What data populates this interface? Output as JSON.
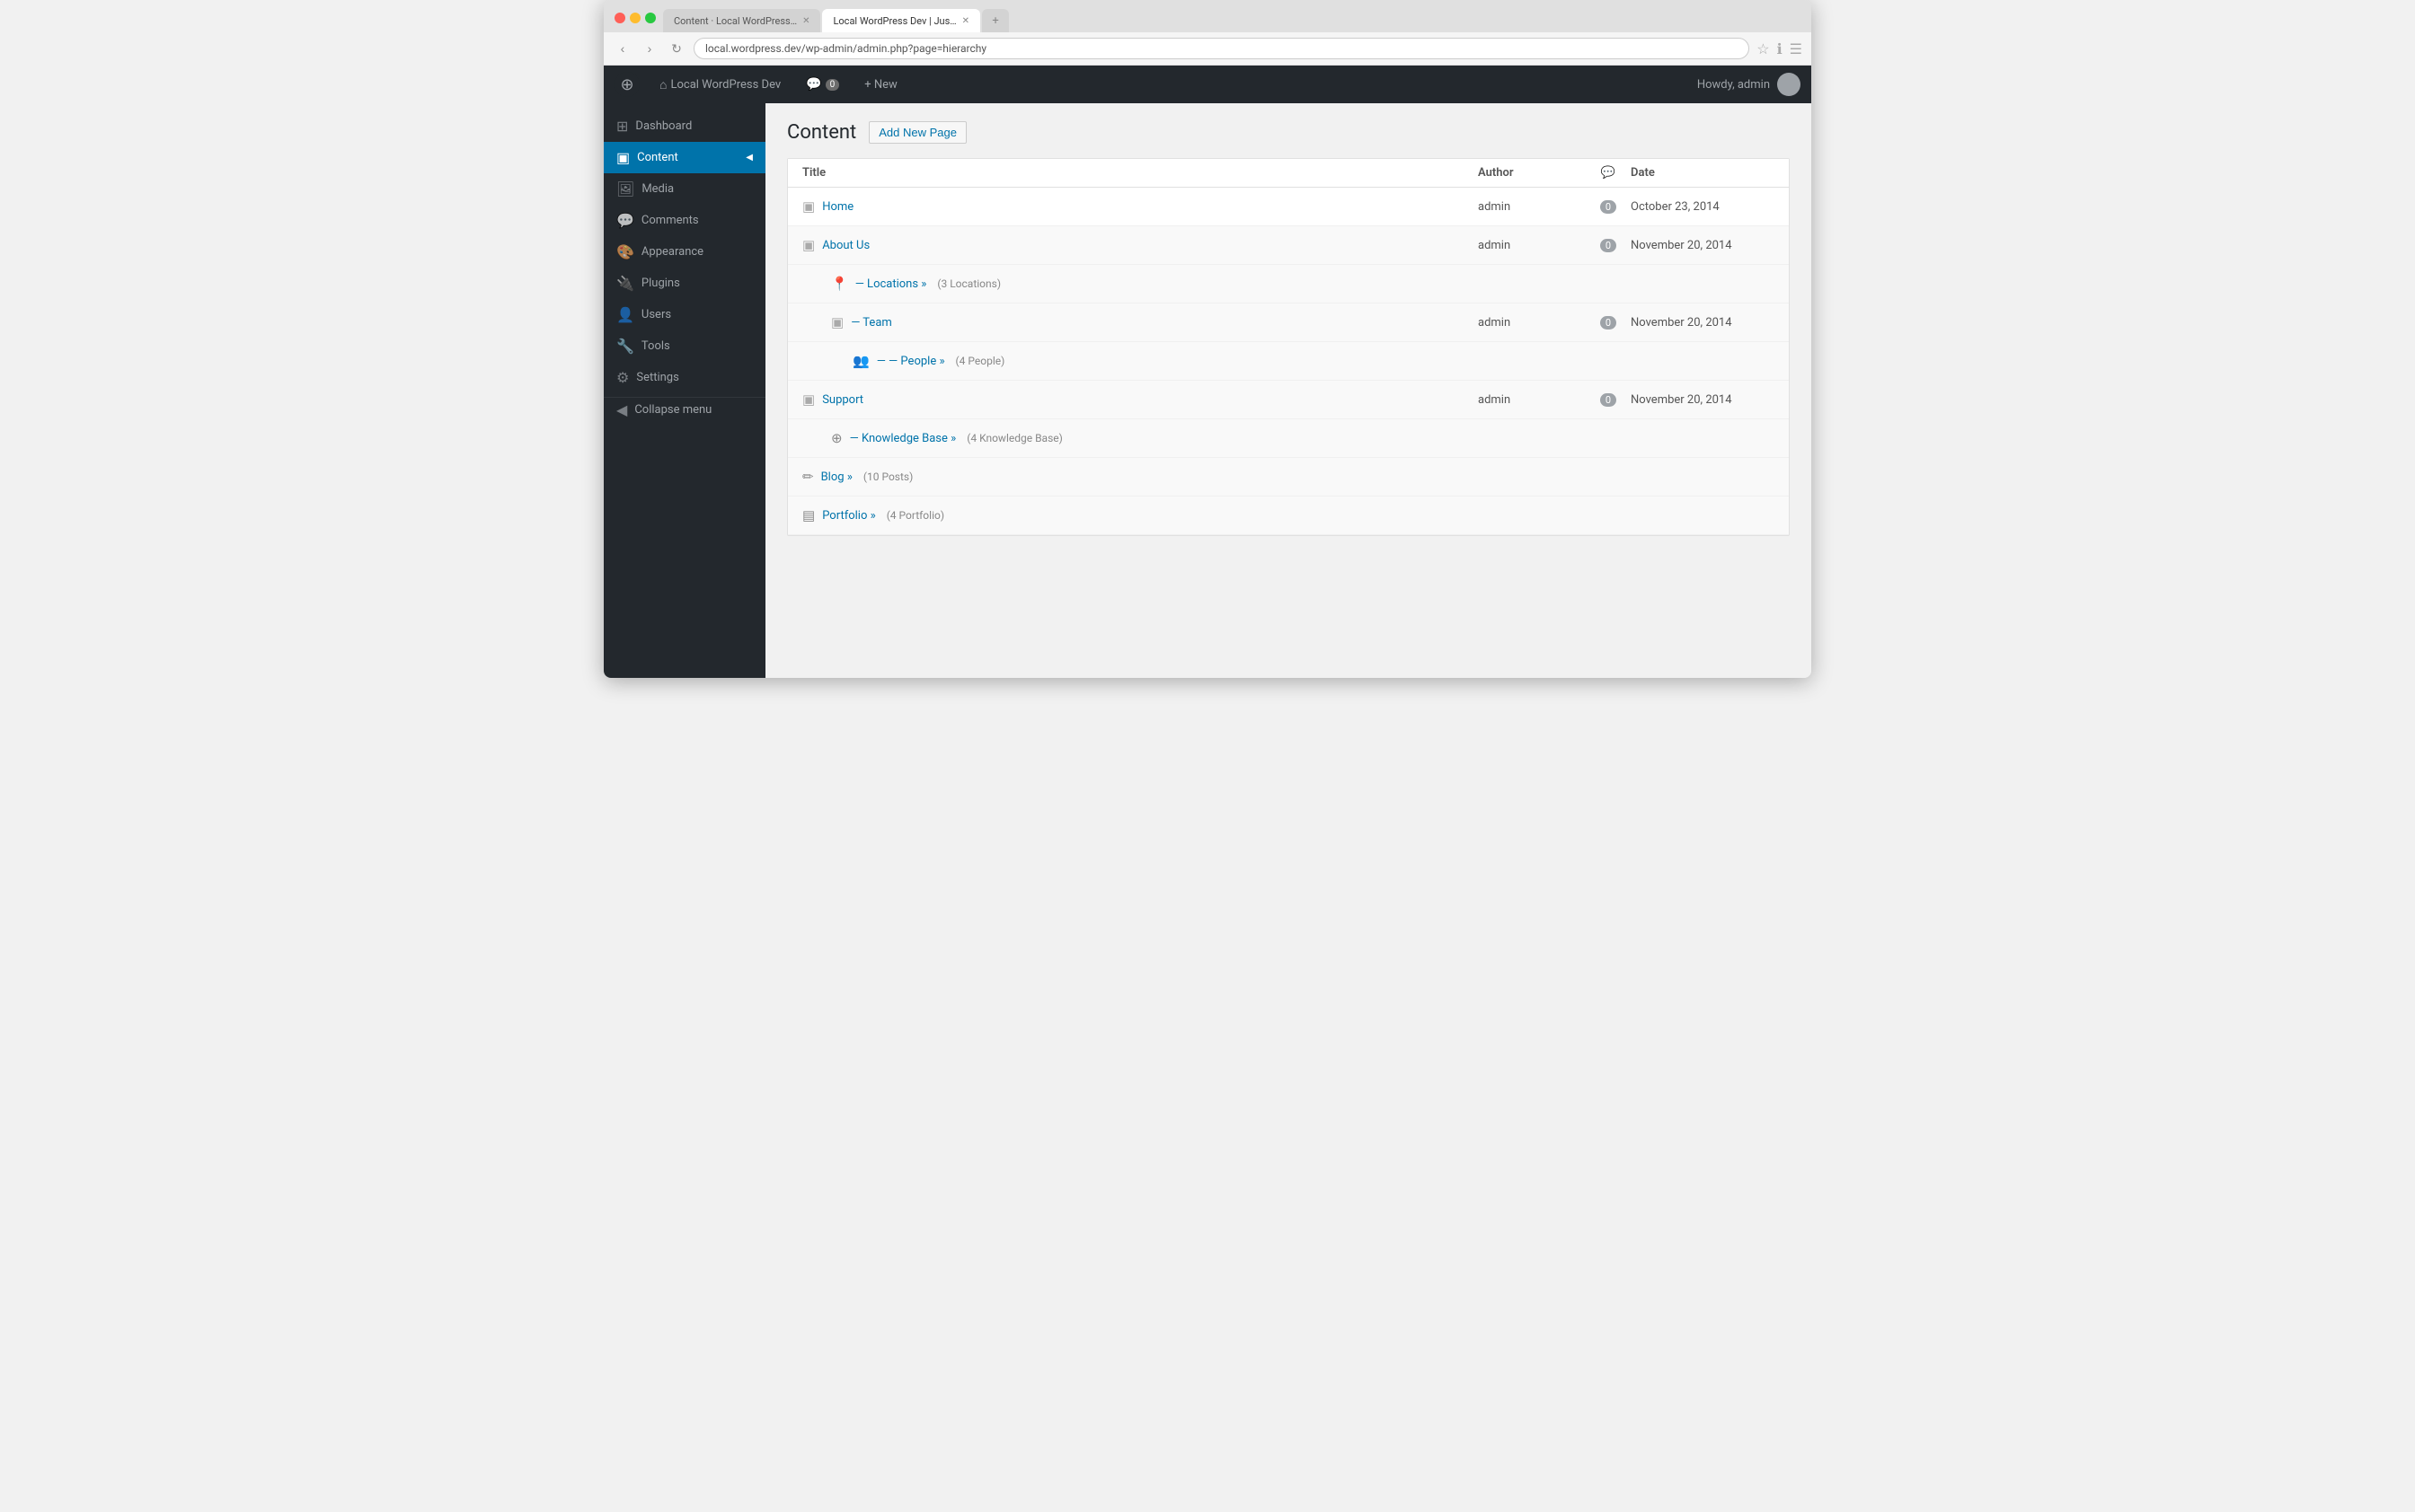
{
  "browser": {
    "tabs": [
      {
        "label": "Content · Local WordPress…",
        "active": false,
        "id": "tab1"
      },
      {
        "label": "Local WordPress Dev | Jus…",
        "active": true,
        "id": "tab2"
      }
    ],
    "address": "local.wordpress.dev/wp-admin/admin.php?page=hierarchy"
  },
  "admin_bar": {
    "site_name": "Local WordPress Dev",
    "comments_count": "0",
    "new_label": "+ New",
    "howdy": "Howdy, admin"
  },
  "sidebar": {
    "items": [
      {
        "id": "dashboard",
        "label": "Dashboard",
        "icon": "⊞",
        "active": false
      },
      {
        "id": "content",
        "label": "Content",
        "icon": "📄",
        "active": true
      },
      {
        "id": "media",
        "label": "Media",
        "icon": "🖼",
        "active": false
      },
      {
        "id": "comments",
        "label": "Comments",
        "icon": "💬",
        "active": false
      },
      {
        "id": "appearance",
        "label": "Appearance",
        "icon": "🎨",
        "active": false
      },
      {
        "id": "plugins",
        "label": "Plugins",
        "icon": "🔌",
        "active": false
      },
      {
        "id": "users",
        "label": "Users",
        "icon": "👤",
        "active": false
      },
      {
        "id": "tools",
        "label": "Tools",
        "icon": "🔧",
        "active": false
      },
      {
        "id": "settings",
        "label": "Settings",
        "icon": "⚙",
        "active": false
      }
    ],
    "collapse_label": "Collapse menu"
  },
  "page": {
    "title": "Content",
    "add_new_label": "Add New Page"
  },
  "table": {
    "columns": [
      {
        "id": "title",
        "label": "Title"
      },
      {
        "id": "author",
        "label": "Author"
      },
      {
        "id": "comments",
        "label": "💬"
      },
      {
        "id": "date",
        "label": "Date"
      }
    ],
    "rows": [
      {
        "id": "home",
        "indent": 0,
        "icon": "page",
        "title": "Home",
        "author": "admin",
        "comments": "0",
        "date": "October 23, 2014",
        "has_link": true,
        "child_meta": null
      },
      {
        "id": "about-us",
        "indent": 0,
        "icon": "page",
        "title": "About Us",
        "author": "admin",
        "comments": "0",
        "date": "November 20, 2014",
        "has_link": true,
        "child_meta": null
      },
      {
        "id": "locations",
        "indent": 1,
        "icon": "pin",
        "title": "— Locations »",
        "author": "",
        "comments": "",
        "date": "",
        "has_link": true,
        "child_meta": "(3 Locations)"
      },
      {
        "id": "team",
        "indent": 1,
        "icon": "page",
        "title": "— Team",
        "author": "admin",
        "comments": "0",
        "date": "November 20, 2014",
        "has_link": true,
        "child_meta": null
      },
      {
        "id": "people",
        "indent": 2,
        "icon": "group",
        "title": "— — People »",
        "author": "",
        "comments": "",
        "date": "",
        "has_link": true,
        "child_meta": "(4 People)"
      },
      {
        "id": "support",
        "indent": 0,
        "icon": "page",
        "title": "Support",
        "author": "admin",
        "comments": "0",
        "date": "November 20, 2014",
        "has_link": true,
        "child_meta": null
      },
      {
        "id": "knowledge-base",
        "indent": 1,
        "icon": "globe",
        "title": "— Knowledge Base »",
        "author": "",
        "comments": "",
        "date": "",
        "has_link": true,
        "child_meta": "(4 Knowledge Base)"
      },
      {
        "id": "blog",
        "indent": 0,
        "icon": "pin2",
        "title": "Blog »",
        "author": "",
        "comments": "",
        "date": "",
        "has_link": true,
        "child_meta": "(10 Posts)"
      },
      {
        "id": "portfolio",
        "indent": 0,
        "icon": "film",
        "title": "Portfolio »",
        "author": "",
        "comments": "",
        "date": "",
        "has_link": true,
        "child_meta": "(4 Portfolio)"
      }
    ]
  }
}
